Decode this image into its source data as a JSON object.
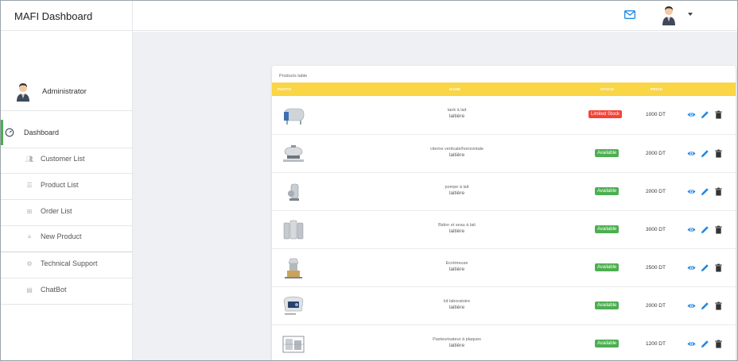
{
  "sidebar": {
    "brand": "MAFI Dashboard",
    "user_name": "Administrator",
    "items": [
      {
        "label": "Dashboard",
        "icon": "speedometer-icon"
      },
      {
        "label": "Customer List",
        "icon": "people-icon"
      },
      {
        "label": "Product List",
        "icon": "list-icon"
      },
      {
        "label": "Order List",
        "icon": "grid-icon"
      },
      {
        "label": "New Product",
        "icon": "add-list-icon"
      },
      {
        "label": "Technical Support",
        "icon": "support-icon"
      },
      {
        "label": "ChatBot",
        "icon": "chat-icon"
      }
    ]
  },
  "topbar": {
    "mail_icon": "mail-icon",
    "avatar_icon": "user-avatar-icon",
    "menu_icon": "caret-down-icon"
  },
  "table": {
    "title": "Products table",
    "headers": {
      "photo": "PHOTO",
      "name": "NAME",
      "stock": "STOCK",
      "price": "PRICE"
    },
    "rows": [
      {
        "name": "tank à lait",
        "category": "laitière",
        "stock": "Limited Stock",
        "stock_status": "limited",
        "price": "1000 DT"
      },
      {
        "name": "citerne verticale/horizontale",
        "category": "laitière",
        "stock": "Available",
        "stock_status": "available",
        "price": "2000 DT"
      },
      {
        "name": "pompe à lait",
        "category": "laitière",
        "stock": "Available",
        "stock_status": "available",
        "price": "2000 DT"
      },
      {
        "name": "Bidon et seau à lait",
        "category": "laitière",
        "stock": "Available",
        "stock_status": "available",
        "price": "3000 DT"
      },
      {
        "name": "Ecrémeuse",
        "category": "laitière",
        "stock": "Available",
        "stock_status": "available",
        "price": "2500 DT"
      },
      {
        "name": "kit laboratoire",
        "category": "laitière",
        "stock": "Available",
        "stock_status": "available",
        "price": "2000 DT"
      },
      {
        "name": "Pasteurisateur à plaques",
        "category": "laitière",
        "stock": "Available",
        "stock_status": "available",
        "price": "1200 DT"
      }
    ]
  },
  "colors": {
    "header_yellow": "#fad545",
    "available_green": "#4caf50",
    "limited_red": "#f44336",
    "action_blue": "#1e88e5",
    "active_green": "#4caf50"
  }
}
